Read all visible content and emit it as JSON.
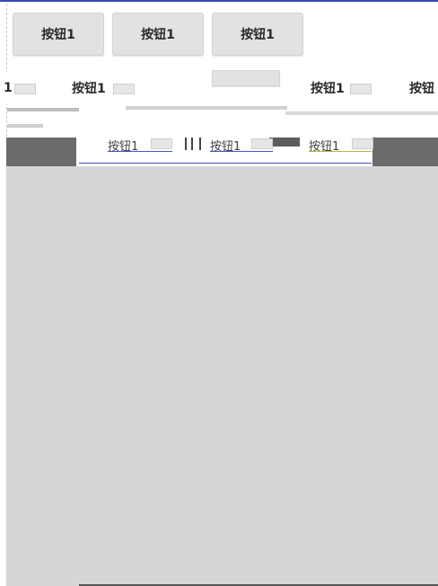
{
  "row1": {
    "buttons": [
      "按钮1",
      "按钮1",
      "按钮1"
    ]
  },
  "row2": {
    "edge_left": "1",
    "buttons": [
      "按钮1",
      "按钮1",
      "按钮"
    ]
  },
  "row3": {
    "buttons": [
      "按钮1",
      "按钮1",
      "按钮1"
    ]
  },
  "colors": {
    "top_accent": "#3c4ab3",
    "button_bg": "#e2e2e2",
    "content_bg": "#d6d6d6",
    "dark_block": "#6b6b6b"
  }
}
